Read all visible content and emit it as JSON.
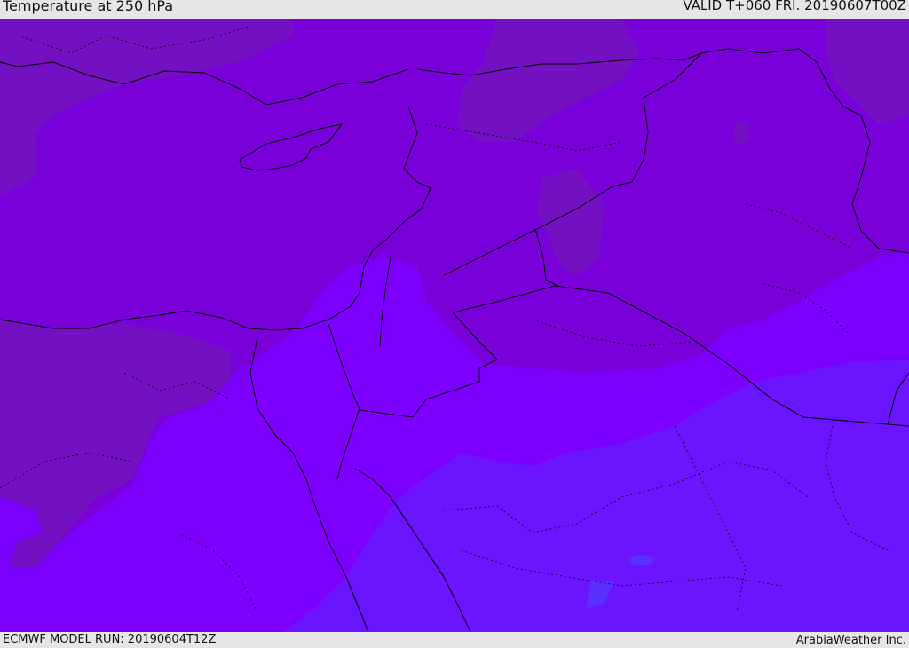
{
  "header": {
    "title": "Temperature at 250 hPa",
    "valid_time": "VALID T+060 FRI. 20190607T00Z"
  },
  "footer": {
    "model_run": "ECMWF MODEL RUN: 20190604T12Z",
    "credit": "ArabiaWeather Inc."
  },
  "colors": {
    "warm_band": "#7a00da",
    "warmer_band": "#7d00ff",
    "mid_band": "#6a14ff",
    "darker_patch": "#7210c2",
    "spot": "#5a30ff",
    "border_line": "#000000"
  }
}
